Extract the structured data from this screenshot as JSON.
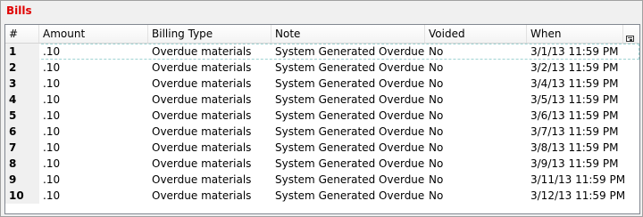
{
  "panel": {
    "title": "Bills"
  },
  "table": {
    "columns": {
      "num": "#",
      "amount": "Amount",
      "billing_type": "Billing Type",
      "note": "Note",
      "voided": "Voided",
      "when": "When"
    },
    "menu_icon": "column-chooser-icon",
    "rows": [
      {
        "num": "1",
        "amount": ".10",
        "billing_type": "Overdue materials",
        "note": "System Generated Overdue Fine",
        "voided": "No",
        "when": "3/1/13 11:59 PM"
      },
      {
        "num": "2",
        "amount": ".10",
        "billing_type": "Overdue materials",
        "note": "System Generated Overdue Fine",
        "voided": "No",
        "when": "3/2/13 11:59 PM"
      },
      {
        "num": "3",
        "amount": ".10",
        "billing_type": "Overdue materials",
        "note": "System Generated Overdue Fine",
        "voided": "No",
        "when": "3/4/13 11:59 PM"
      },
      {
        "num": "4",
        "amount": ".10",
        "billing_type": "Overdue materials",
        "note": "System Generated Overdue Fine",
        "voided": "No",
        "when": "3/5/13 11:59 PM"
      },
      {
        "num": "5",
        "amount": ".10",
        "billing_type": "Overdue materials",
        "note": "System Generated Overdue Fine",
        "voided": "No",
        "when": "3/6/13 11:59 PM"
      },
      {
        "num": "6",
        "amount": ".10",
        "billing_type": "Overdue materials",
        "note": "System Generated Overdue Fine",
        "voided": "No",
        "when": "3/7/13 11:59 PM"
      },
      {
        "num": "7",
        "amount": ".10",
        "billing_type": "Overdue materials",
        "note": "System Generated Overdue Fine",
        "voided": "No",
        "when": "3/8/13 11:59 PM"
      },
      {
        "num": "8",
        "amount": ".10",
        "billing_type": "Overdue materials",
        "note": "System Generated Overdue Fine",
        "voided": "No",
        "when": "3/9/13 11:59 PM"
      },
      {
        "num": "9",
        "amount": ".10",
        "billing_type": "Overdue materials",
        "note": "System Generated Overdue Fine",
        "voided": "No",
        "when": "3/11/13 11:59 PM"
      },
      {
        "num": "10",
        "amount": ".10",
        "billing_type": "Overdue materials",
        "note": "System Generated Overdue Fine",
        "voided": "No",
        "when": "3/12/13 11:59 PM"
      }
    ]
  }
}
